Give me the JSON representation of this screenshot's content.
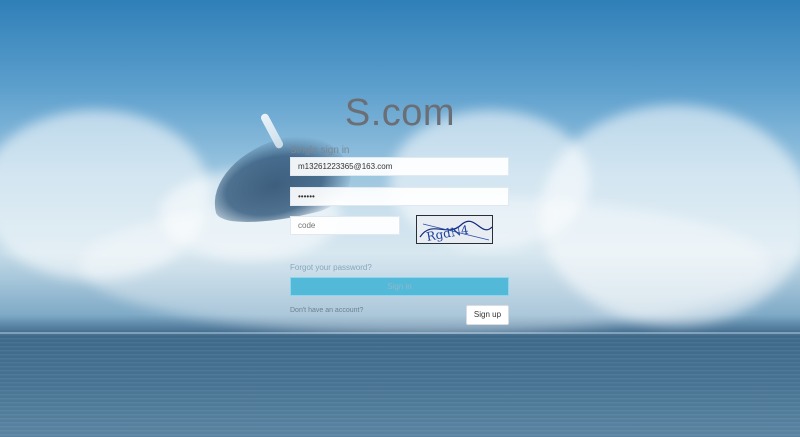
{
  "brand": {
    "title": "S.com"
  },
  "form": {
    "title": "Single sign in",
    "email_value": "m13261223365@163.com",
    "password_value": "••••••",
    "captcha_placeholder": "code",
    "captcha_text": "RgdN4",
    "forgot_label": "Forgot your password?",
    "signin_label": "Sign in",
    "no_account_label": "Don't have an account?",
    "signup_label": "Sign up"
  },
  "colors": {
    "signin_button": "#52b9d9",
    "brand_text": "#6b6f75"
  },
  "icons": {
    "captcha": "captcha-image"
  }
}
